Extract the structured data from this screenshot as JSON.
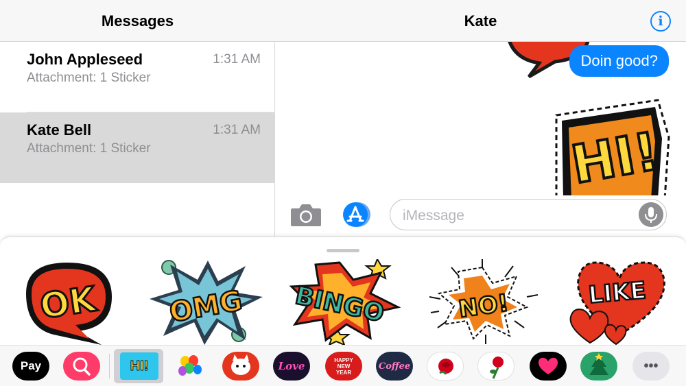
{
  "sidebar": {
    "title": "Messages",
    "conversations": [
      {
        "name": "John Appleseed",
        "time": "1:31 AM",
        "preview": "Attachment: 1 Sticker",
        "selected": false
      },
      {
        "name": "Kate Bell",
        "time": "1:31 AM",
        "preview": "Attachment: 1 Sticker",
        "selected": true
      }
    ]
  },
  "conversation": {
    "title": "Kate",
    "info_icon": "info-icon",
    "messages": [
      {
        "type": "text",
        "direction": "outgoing",
        "text": "Doin good?"
      },
      {
        "type": "sticker",
        "direction": "outgoing",
        "sticker": "HI!"
      }
    ],
    "input": {
      "placeholder": "iMessage",
      "camera_icon": "camera-icon",
      "appstore_icon": "app-store-icon",
      "mic_icon": "microphone-icon"
    }
  },
  "sticker_drawer": {
    "stickers": [
      "OK",
      "OMG",
      "BINGO",
      "NO!",
      "LIKE"
    ],
    "apps": [
      {
        "name": "apple-pay",
        "label": "Pay"
      },
      {
        "name": "image-search",
        "label": ""
      },
      {
        "name": "hi-stickers",
        "label": "HI!",
        "selected": true
      },
      {
        "name": "balloons",
        "label": ""
      },
      {
        "name": "cat-stickers",
        "label": ""
      },
      {
        "name": "love-stickers",
        "label": "Love"
      },
      {
        "name": "happy-new-year",
        "label": "HAPPY NEW YEAR"
      },
      {
        "name": "coffee-stickers",
        "label": "Coffee"
      },
      {
        "name": "rose",
        "label": ""
      },
      {
        "name": "rose-2",
        "label": ""
      },
      {
        "name": "heart",
        "label": ""
      },
      {
        "name": "christmas-tree",
        "label": ""
      },
      {
        "name": "more",
        "label": "•••"
      }
    ]
  },
  "colors": {
    "accent_blue": "#0a84ff",
    "selected_row": "#d9d9d9",
    "secondary_text": "#8e8e93"
  }
}
